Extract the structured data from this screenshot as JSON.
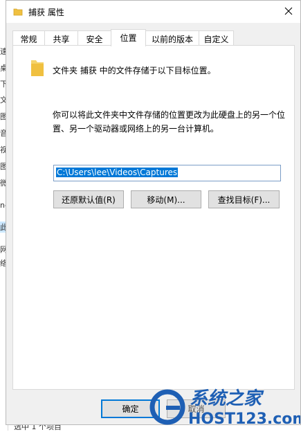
{
  "background": {
    "side_glyphs": [
      "速",
      "桌",
      "下",
      "文",
      "图",
      "音",
      "视",
      "图",
      "微",
      "ne",
      "此",
      "网",
      "络"
    ],
    "status_text": "选中 1 个项目"
  },
  "dialog": {
    "title": "捕获 属性",
    "tabs": [
      {
        "label": "常规"
      },
      {
        "label": "共享"
      },
      {
        "label": "安全"
      },
      {
        "label": "位置"
      },
      {
        "label": "以前的版本"
      },
      {
        "label": "自定义"
      }
    ],
    "active_tab": "位置",
    "location_text": "文件夹 捕获 中的文件存储于以下目标位置。",
    "description": "你可以将此文件夹中文件存储的位置更改为此硬盘上的另一个位置、另一个驱动器或网络上的另一台计算机。",
    "path_value": "C:\\Users\\lee\\Videos\\Captures",
    "buttons": {
      "restore": "还原默认值(R)",
      "move": "移动(M)...",
      "find": "查找目标(F)..."
    },
    "footer": {
      "ok": "确定",
      "cancel": "取消"
    }
  },
  "watermark": {
    "top_text": "系统之家",
    "bottom_text": "HOST123.com"
  },
  "colors": {
    "selection": "#0078d7",
    "folder": "#f0c040",
    "watermark_blue": "#1e5fb4"
  }
}
